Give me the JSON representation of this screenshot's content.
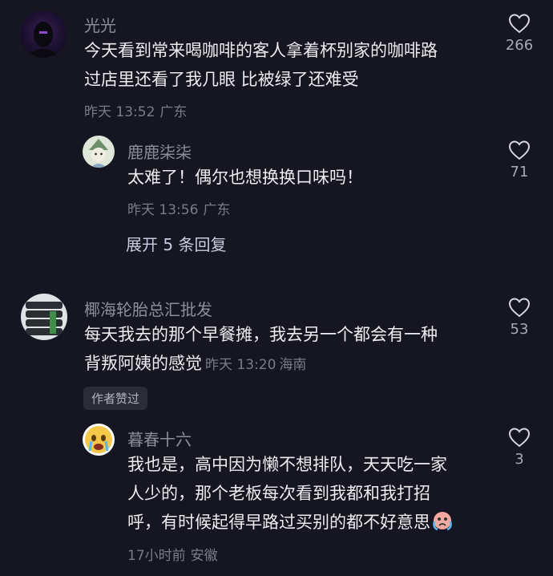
{
  "comments": [
    {
      "user": "光光",
      "lines": [
        "今天看到常来喝咖啡的客人拿着杯别家的咖啡路",
        "过店里还看了我几眼 比被绿了还难受"
      ],
      "time": "昨天 13:52",
      "location": "广东",
      "likes": "266",
      "reply": {
        "user": "鹿鹿柒柒",
        "text": "太难了！偶尔也想换换口味吗！",
        "time": "昨天 13:56",
        "location": "广东",
        "likes": "71"
      },
      "expand_label": "展开 5 条回复"
    },
    {
      "user": "椰海轮胎总汇批发",
      "line1": "每天我去的那个早餐摊，我去另一个都会有一种",
      "line2": "背叛阿姨的感觉",
      "time": "昨天 13:20",
      "location": "海南",
      "likes": "53",
      "badge": "作者赞过",
      "reply": {
        "user": "暮春十六",
        "lines": [
          "我也是，高中因为懒不想排队，天天吃一家",
          "人少的，那个老板每次看到我都和我打招",
          "呼，有时候起得早路过买别的都不好意思"
        ],
        "time": "17小时前",
        "location": "安徽",
        "likes": "3"
      }
    }
  ],
  "colors": {
    "background": "#161622",
    "text": "#ececf1",
    "meta": "#7c7c87"
  }
}
